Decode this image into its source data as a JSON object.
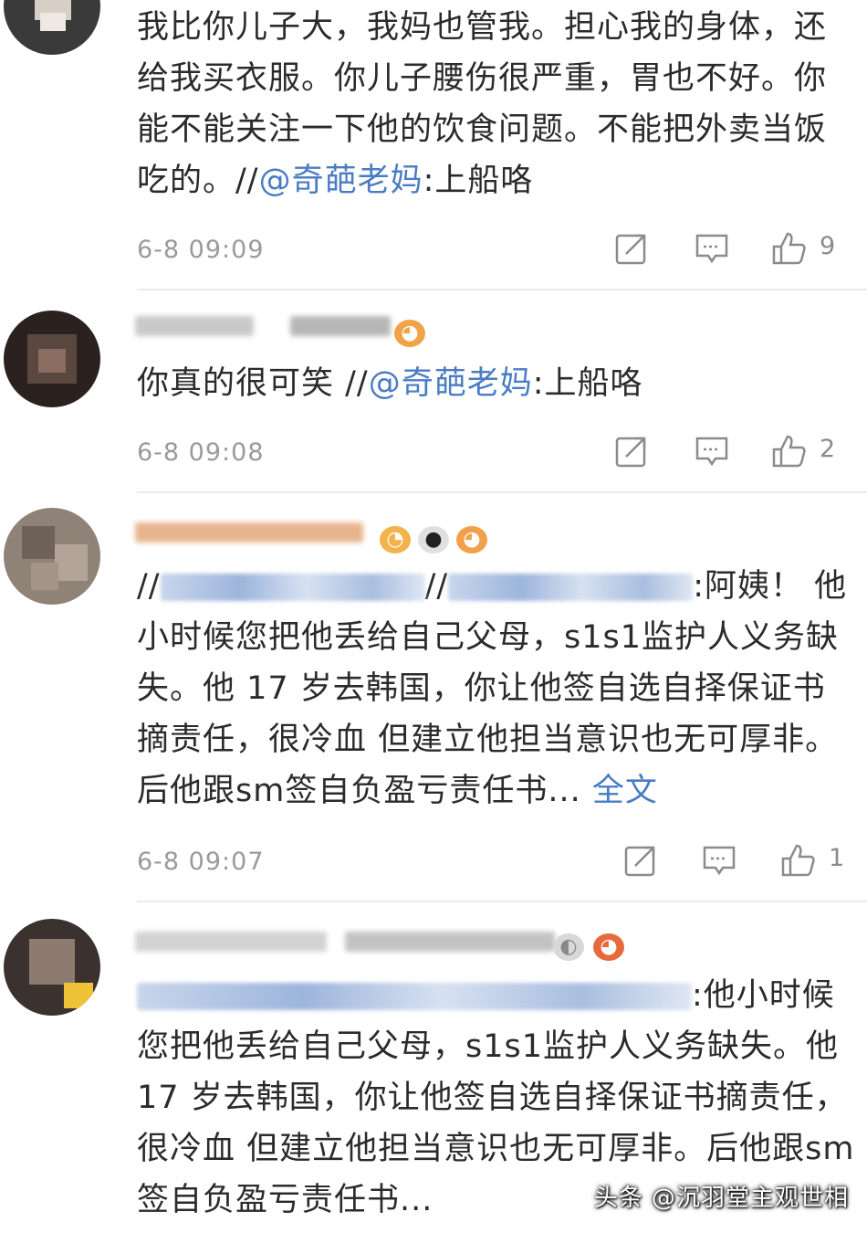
{
  "comments": [
    {
      "body_plain": "我比你儿子大，我妈也管我。担心我的身体，还给我买衣服。你儿子腰伤很严重，胃也不好。你能不能关注一下他的饮食问题。不能把外卖当饭吃的。//",
      "mention": "@奇葩老妈",
      "suffix": ":上船咯",
      "time": "6-8 09:09",
      "likes": "9"
    },
    {
      "body_plain": "你真的很可笑 //",
      "mention": "@奇葩老妈",
      "suffix": ":上船咯",
      "time": "6-8 09:08",
      "likes": "2"
    },
    {
      "body_prefix": "//",
      "body_mid": "//",
      "suffix": ":阿姨！ 他小时候您把他丢给自己父母，s1s1监护人义务缺失。他 17 岁去韩国，你让他签自选自择保证书摘责任，很冷血 但建立他担当意识也无可厚非。后他跟sm签自负盈亏责任书...",
      "more": "全文",
      "time": "6-8 09:07",
      "likes": "1"
    },
    {
      "suffix": ":他小时候您把他丢给自己父母，s1s1监护人义务缺失。他 17 岁去韩国，你让他签自选自择保证书摘责任，很冷血 但建立他担当意识也无可厚非。后他跟sm签自负盈亏责任书..."
    }
  ],
  "watermark": "头条 @沉羽堂主观世相",
  "icons": {
    "repost": "share-square-icon",
    "comment": "comment-bubble-icon",
    "like": "thumbs-up-icon"
  },
  "colors": {
    "link": "#4a7cc4",
    "meta": "#9a9a9a",
    "text": "#2b2b2b"
  }
}
